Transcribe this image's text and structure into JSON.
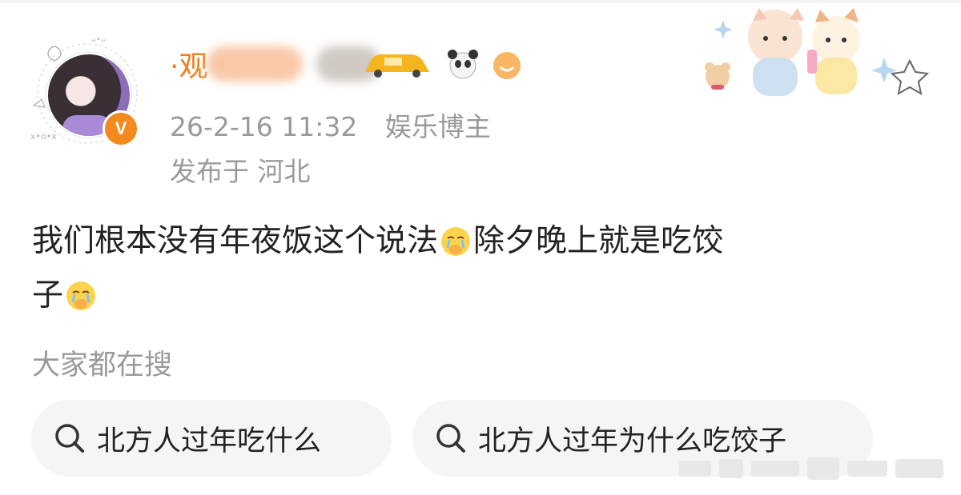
{
  "post": {
    "author": {
      "name_prefix": "·观",
      "verified_badge": "V"
    },
    "timestamp": "26-2-16 11:32",
    "role": "娱乐博主",
    "location": "发布于 河北",
    "text_part1": "我们根本没有年夜饭这个说法",
    "text_part2": "除夕晚上就是吃饺",
    "text_part3": "子",
    "emoji": "crying-cover-mouth-emoji"
  },
  "search": {
    "heading": "大家都在搜",
    "chips": [
      {
        "label": "北方人过年吃什么"
      },
      {
        "label": "北方人过年为什么吃饺子"
      }
    ]
  },
  "colors": {
    "accent": "#f07e1b",
    "meta": "#9a9a9a",
    "chip_bg": "#f5f5f5"
  }
}
